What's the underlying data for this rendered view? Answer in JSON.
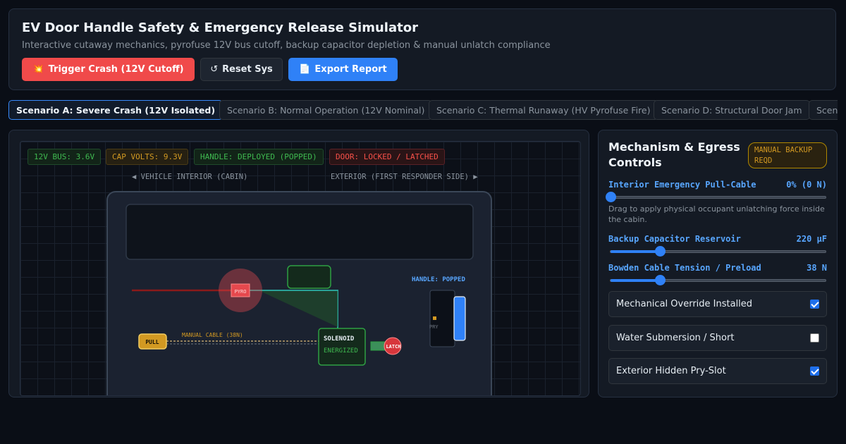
{
  "header": {
    "title": "EV Door Handle Safety & Emergency Release Simulator",
    "subtitle": "Interactive cutaway mechanics, pyrofuse 12V bus cutoff, backup capacitor depletion & manual unlatch compliance",
    "buttons": {
      "trigger": {
        "icon": "💥",
        "label": "Trigger Crash (12V Cutoff)"
      },
      "reset": {
        "icon": "↺",
        "label": "Reset Sys"
      },
      "export": {
        "icon": "📄",
        "label": "Export Report"
      }
    }
  },
  "tabs": [
    {
      "label": "Scenario A: Severe Crash (12V Isolated)",
      "active": true
    },
    {
      "label": "Scenario B: Normal Operation (12V Nominal)",
      "active": false
    },
    {
      "label": "Scenario C: Thermal Runaway (HV Pyrofuse Fire)",
      "active": false
    },
    {
      "label": "Scenario D: Structural Door Jam",
      "active": false
    },
    {
      "label": "Scenario E",
      "active": false
    }
  ],
  "stage": {
    "status": {
      "bus": "12V BUS: 3.6V",
      "cap": "CAP VOLTS: 9.3V",
      "handle": "HANDLE: DEPLOYED (POPPED)",
      "door": "DOOR: LOCKED / LATCHED"
    },
    "interior_label": "◀ VEHICLE INTERIOR (CABIN)",
    "exterior_label": "EXTERIOR (FIRST RESPONDER SIDE) ▶",
    "diagram": {
      "pyro": "PYRO",
      "pull": "PULL",
      "manual_cable": "MANUAL CABLE (38N)",
      "solenoid": "SOLENOID",
      "solenoid_state": "ENERGIZED",
      "latch": "LATCH",
      "handle_state": "HANDLE: POPPED",
      "pry": "PRY"
    },
    "colors": {
      "ok": "#3fb950",
      "warn": "#d29922",
      "alert": "#f85149",
      "accent": "#58a6ff"
    }
  },
  "panel": {
    "title": "Mechanism & Egress Controls",
    "badge": "MANUAL BACKUP REQD",
    "controls": [
      {
        "label": "Interior Emergency Pull-Cable",
        "value": "0% (0 N)",
        "fraction": 0.0
      },
      {
        "label": "Backup Capacitor Reservoir",
        "value": "220 μF",
        "fraction": 0.23
      },
      {
        "label": "Bowden Cable Tension / Preload",
        "value": "38 N",
        "fraction": 0.23
      }
    ],
    "hint": "Drag to apply physical occupant unlatching force inside the cabin.",
    "toggles": [
      {
        "label": "Mechanical Override Installed",
        "checked": true
      },
      {
        "label": "Water Submersion / Short",
        "checked": false
      },
      {
        "label": "Exterior Hidden Pry-Slot",
        "checked": true
      }
    ]
  }
}
